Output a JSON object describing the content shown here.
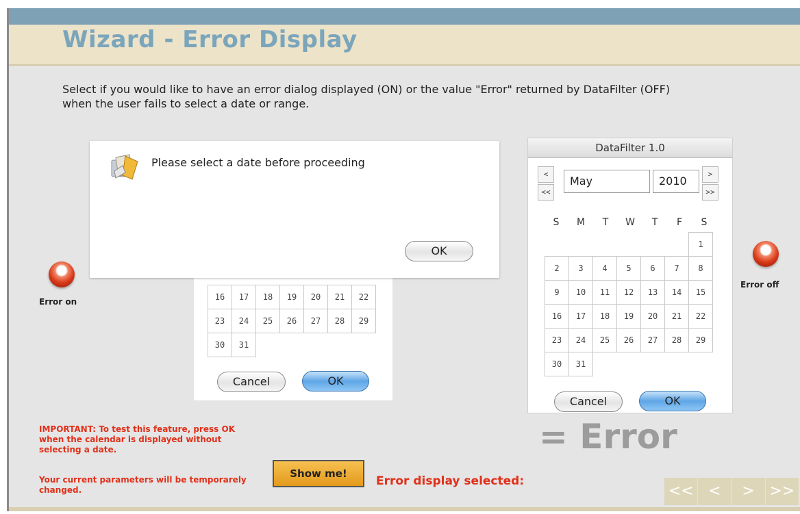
{
  "header": {
    "title": "Wizard - Error Display"
  },
  "instructions": "Select if you would like to have an error dialog displayed (ON) or the value \"Error\" returned by DataFilter (OFF) when the user fails to select a date or range.",
  "options": {
    "on_label": "Error on",
    "off_label": "Error off"
  },
  "error_dialog": {
    "message": "Please select a date before proceeding",
    "ok_label": "OK",
    "icon": "warning-folder-icon"
  },
  "left_calendar": {
    "rows": [
      [
        "16",
        "17",
        "18",
        "19",
        "20",
        "21",
        "22"
      ],
      [
        "23",
        "24",
        "25",
        "26",
        "27",
        "28",
        "29"
      ],
      [
        "30",
        "31",
        "",
        "",
        "",
        "",
        ""
      ]
    ],
    "cancel_label": "Cancel",
    "ok_label": "OK"
  },
  "datafilter": {
    "title": "DataFilter 1.0",
    "month": "May",
    "year": "2010",
    "prev_month": "<",
    "prev_year": "<<",
    "next_month": ">",
    "next_year": ">>",
    "weekdays": [
      "S",
      "M",
      "T",
      "W",
      "T",
      "F",
      "S"
    ],
    "weeks": [
      [
        "",
        "",
        "",
        "",
        "",
        "",
        "1"
      ],
      [
        "2",
        "3",
        "4",
        "5",
        "6",
        "7",
        "8"
      ],
      [
        "9",
        "10",
        "11",
        "12",
        "13",
        "14",
        "15"
      ],
      [
        "16",
        "17",
        "18",
        "19",
        "20",
        "21",
        "22"
      ],
      [
        "23",
        "24",
        "25",
        "26",
        "27",
        "28",
        "29"
      ],
      [
        "30",
        "31",
        "",
        "",
        "",
        "",
        ""
      ]
    ],
    "cancel_label": "Cancel",
    "ok_label": "OK"
  },
  "result_text": "= Error",
  "important_note": "IMPORTANT: To test this feature, press OK when the calendar is displayed without selecting a date.",
  "params_note": "Your current parameters will be temporarely changed.",
  "show_me_label": "Show me!",
  "selected_label": "Error display selected:",
  "nav": {
    "first": "<<",
    "prev": "<",
    "next": ">",
    "last": ">>"
  },
  "colors": {
    "accent": "#7ba5bb",
    "warning_text": "#e0301a",
    "title_bar": "#ece3c9",
    "top_bar": "#7fa1b5"
  }
}
